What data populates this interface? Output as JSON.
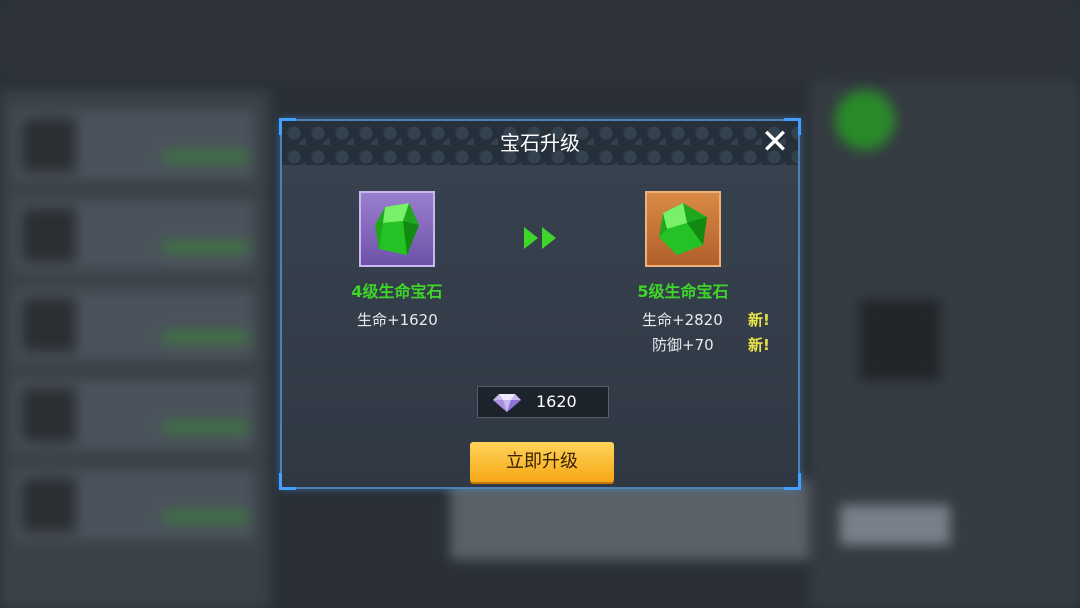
{
  "dialog": {
    "title": "宝石升级",
    "close_icon": "close-icon"
  },
  "current_gem": {
    "name": "4级生命宝石",
    "stat": "生命+1620",
    "icon": "green-gem-icon",
    "frame_color": "#8a6cc4"
  },
  "next_gem": {
    "name": "5级生命宝石",
    "stats": [
      {
        "text": "生命+2820",
        "badge": "新!"
      },
      {
        "text": "防御+70",
        "badge": "新!"
      }
    ],
    "icon": "green-gem-icon",
    "frame_color": "#c97a3a"
  },
  "cost": {
    "icon": "diamond-icon",
    "value": "1620"
  },
  "upgrade_button": {
    "label": "立即升级"
  },
  "colors": {
    "gem_name": "#3fd62a",
    "new_badge": "#e8e24a",
    "button": "#f7a816",
    "border": "#4e7fb5"
  }
}
